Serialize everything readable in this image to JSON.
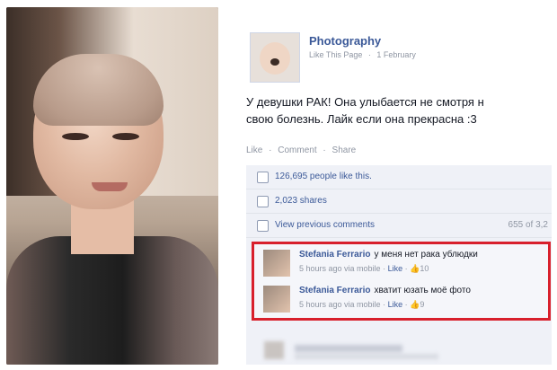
{
  "post": {
    "page_name": "Photography",
    "meta": {
      "like_page": "Like This Page",
      "dot": "·",
      "date": "1 February"
    },
    "text": "У девушки РАК! Она улыбается не смотря н\nсвою болезнь. Лайк если она прекрасна :3",
    "actions": {
      "like": "Like",
      "dot": "·",
      "comment": "Comment",
      "share": "Share"
    }
  },
  "ufi": {
    "likes": "126,695 people like this.",
    "shares": "2,023 shares",
    "view_comments": "View previous comments",
    "comments_count": "655 of 3,2"
  },
  "comments": [
    {
      "author": "Stefania Ferrario",
      "text": "у меня нет рака ублюдки",
      "time": "5 hours ago via mobile",
      "dot": "·",
      "like": "Like",
      "likes": "10"
    },
    {
      "author": "Stefania Ferrario",
      "text": "хватит юзать моё фото",
      "time": "5 hours ago via mobile",
      "dot": "·",
      "like": "Like",
      "likes": "9"
    }
  ],
  "icons": {
    "like": "thumbs-up-icon",
    "share": "share-icon",
    "comment": "comment-bubble-icon"
  },
  "colors": {
    "brand": "#3b5998",
    "highlight": "#d8202c"
  }
}
